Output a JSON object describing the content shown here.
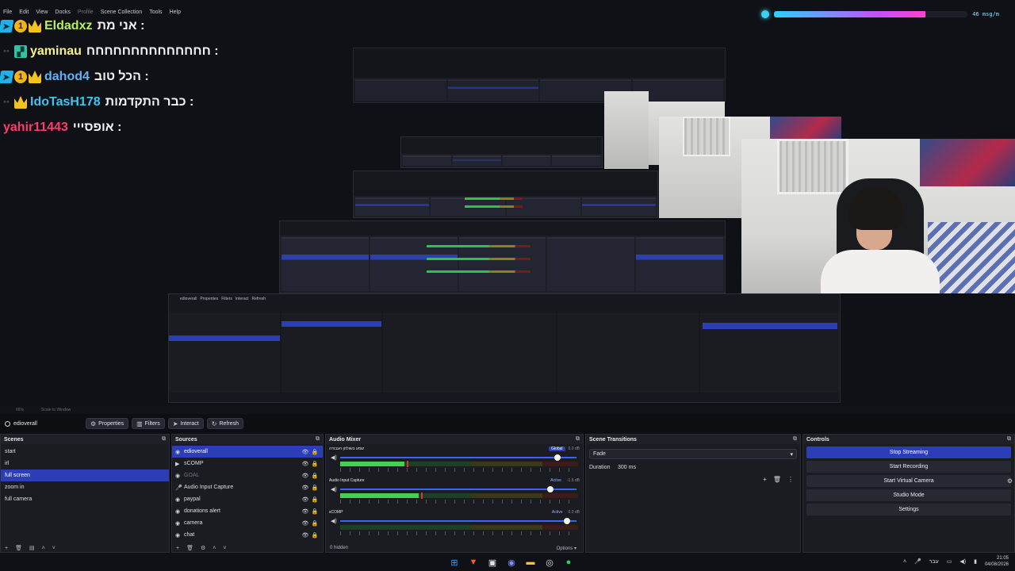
{
  "menubar": {
    "items": [
      "File",
      "Edit",
      "View",
      "Docks",
      "Profile",
      "Scene Collection",
      "Tools",
      "Help"
    ]
  },
  "chat": [
    {
      "name": "Eldadxz",
      "name_color": "#b8f05a",
      "badges": [
        "vip",
        "num",
        "crown"
      ],
      "badge_num": "1",
      "msg": "אני מת :"
    },
    {
      "name": "yaminau",
      "name_color": "#f4f28b",
      "badges": [
        "ghost",
        "sub"
      ],
      "badge_num": "",
      "msg": "חחחחחחחחחחחחחח :"
    },
    {
      "name": "dahod4",
      "name_color": "#5fb2f5",
      "badges": [
        "vip",
        "num",
        "crown"
      ],
      "badge_num": "1",
      "msg": "הכל טוב :"
    },
    {
      "name": "IdoTasH178",
      "name_color": "#3bc6f0",
      "badges": [
        "ghost",
        "crown"
      ],
      "badge_num": "",
      "msg": "כבר התקדמות :"
    },
    {
      "name": "yahir11443",
      "name_color": "#ff3b6b",
      "badges": [],
      "badge_num": "",
      "msg": "אופסייי :"
    }
  ],
  "goal": {
    "text": "46 msg/m",
    "progress": 0.78
  },
  "subbar": {
    "zoom": "66%",
    "mode": "Scale to Window"
  },
  "toolbar": {
    "scene": "edioverall",
    "properties": "Properties",
    "filters": "Filters",
    "interact": "Interact",
    "refresh": "Refresh"
  },
  "scenes": {
    "title": "Scenes",
    "items": [
      "start",
      "irl",
      "full screen",
      "zoom in",
      "full camera"
    ],
    "selected": 2
  },
  "sources": {
    "title": "Sources",
    "items": [
      {
        "name": "edioverall",
        "icon": "◉",
        "state": "sel"
      },
      {
        "name": "sCOMP",
        "icon": "▶",
        "state": ""
      },
      {
        "name": "GOAL",
        "icon": "◉",
        "state": "dim"
      },
      {
        "name": "Audio Input Capture",
        "icon": "🎤",
        "state": ""
      },
      {
        "name": "paypal",
        "icon": "◉",
        "state": ""
      },
      {
        "name": "donations alert",
        "icon": "◉",
        "state": ""
      },
      {
        "name": "camera",
        "icon": "◉",
        "state": ""
      },
      {
        "name": "chat",
        "icon": "◉",
        "state": ""
      }
    ]
  },
  "mixer": {
    "title": "Audio Mixer",
    "channels": [
      {
        "name": "שמע בשולחן העבודה",
        "tag": "Global",
        "db": "0.0 dB",
        "volume": 0.92,
        "level": 0.27
      },
      {
        "name": "Audio Input Capture",
        "tag": "Active",
        "db": "-1.5 dB",
        "volume": 0.89,
        "level": 0.33
      },
      {
        "name": "sCOMP",
        "tag": "Active",
        "db": "0.0 dB",
        "volume": 0.96,
        "level": 0.0
      }
    ],
    "footer": "0 hidden",
    "options": "Options"
  },
  "transitions": {
    "title": "Scene Transitions",
    "type": "Fade",
    "duration_label": "Duration",
    "duration": "300 ms"
  },
  "controls": {
    "title": "Controls",
    "stop_streaming": "Stop Streaming",
    "start_recording": "Start Recording",
    "start_virtual_camera": "Start Virtual Camera",
    "studio_mode": "Studio Mode",
    "settings": "Settings"
  },
  "taskbar": {
    "lang": "עבר",
    "time": "21:05",
    "date": "04/08/2026"
  },
  "colors": {
    "accent": "#2b3db7",
    "meter_green": "#3fd34f",
    "panel": "#1b1c22"
  }
}
